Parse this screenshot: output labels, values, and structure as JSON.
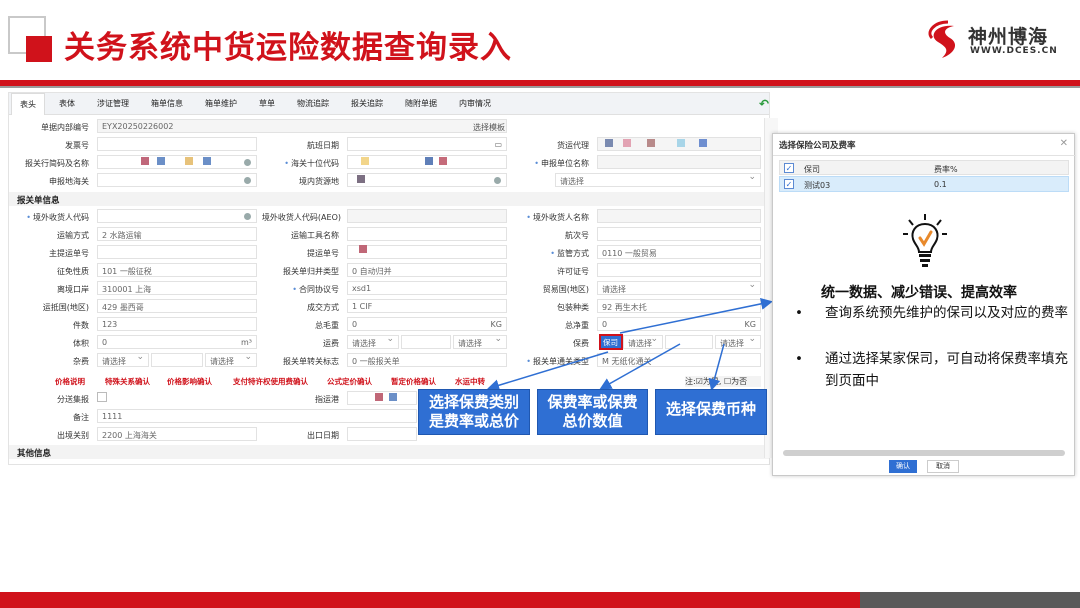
{
  "slide": {
    "title": "关务系统中货运险数据查询录入",
    "logo_cn": "神州博海",
    "logo_en": "WWW.DCES.CN"
  },
  "tabs": [
    "表头",
    "表体",
    "涉证管理",
    "箱单信息",
    "箱单维护",
    "草单",
    "物流追踪",
    "报关追踪",
    "随附单据",
    "内审情况"
  ],
  "form": {
    "internal_no_label": "单据内部编号",
    "internal_no_value": "EYX20250226002",
    "template_button": "选择模板",
    "invoice_label": "发票号",
    "flight_date_label": "航班日期",
    "freight_agent_label": "货运代理",
    "declarant_label": "报关行简码及名称",
    "customs_ten_label": "海关十位代码",
    "declaring_unit_label": "申报单位名称",
    "declare_place_label": "申报地海关",
    "domestic_source_label": "境内货源地",
    "please_select": "请选择",
    "section_declare": "报关单信息",
    "overseas_code_label": "境外收货人代码",
    "overseas_aeo_label": "境外收货人代码(AEO)",
    "overseas_name_label": "境外收货人名称",
    "transport_label": "运输方式",
    "transport_value": "2 水路运输",
    "vehicle_label": "运输工具名称",
    "voyage_label": "航次号",
    "master_bill_label": "主提运单号",
    "bill_label": "提运单号",
    "supervision_label": "监管方式",
    "supervision_value": "0110 一般贸易",
    "tax_label": "征免性质",
    "tax_value": "101 一般征税",
    "declare_merge_label": "报关单归并类型",
    "declare_merge_value": "0 自动归并",
    "license_label": "许可证号",
    "exit_port_label": "离境口岸",
    "exit_port_value": "310001 上海",
    "contract_label": "合同协议号",
    "contract_value": "xsd1",
    "trade_country_label": "贸易国(地区)",
    "dest_country_label": "运抵国(地区)",
    "dest_country_value": "429 墨西哥",
    "deal_mode_label": "成交方式",
    "deal_mode_value": "1 CIF",
    "package_label": "包装种类",
    "package_value": "92 再生木托",
    "pieces_label": "件数",
    "pieces_value": "123",
    "gross_label": "总毛重",
    "gross_value": "0",
    "net_label": "总净重",
    "net_value": "0",
    "kg": "KG",
    "volume_label": "体积",
    "volume_value": "0",
    "volume_unit": "m³",
    "freight_label": "运费",
    "premium_label": "保费",
    "premium_type_value": "保司",
    "misc_label": "杂费",
    "transfer_flag_label": "报关单转关标志",
    "transfer_flag_value": "0 一般报关单",
    "declare_type_label": "报关单通关类型",
    "declare_type_value": "M 无纸化通关",
    "note_right": "注:☑为是, ☐为否",
    "links": [
      "价格说明",
      "特殊关系确认",
      "价格影响确认",
      "支付特许权使用费确认",
      "公式定价确认",
      "暂定价格确认",
      "水运中转"
    ],
    "split_label": "分送集报",
    "port_label": "指运港",
    "remark_label": "备注",
    "remark_value": "1111",
    "exit_customs_label": "出境关别",
    "exit_customs_value": "2200 上海海关",
    "exit_date_label": "出口日期",
    "section_other": "其他信息"
  },
  "callouts": {
    "c1": "选择保费类别\n是费率或总价",
    "c2": "保费率或保费\n总价数值",
    "c3": "选择保费币种"
  },
  "dialog": {
    "title": "选择保险公司及费率",
    "col_company": "保司",
    "col_rate": "费率%",
    "row_company": "测试03",
    "row_rate": "0.1",
    "heading": "统一数据、减少错误、提高效率",
    "bullet1": "查询系统预先维护的保司以及对应的费率",
    "bullet2": "通过选择某家保司，可自动将保费率填充到页面中",
    "ok": "确认",
    "cancel": "取消"
  },
  "colors": {
    "brand_red": "#d0121b",
    "accent_blue": "#2f6fd3"
  }
}
